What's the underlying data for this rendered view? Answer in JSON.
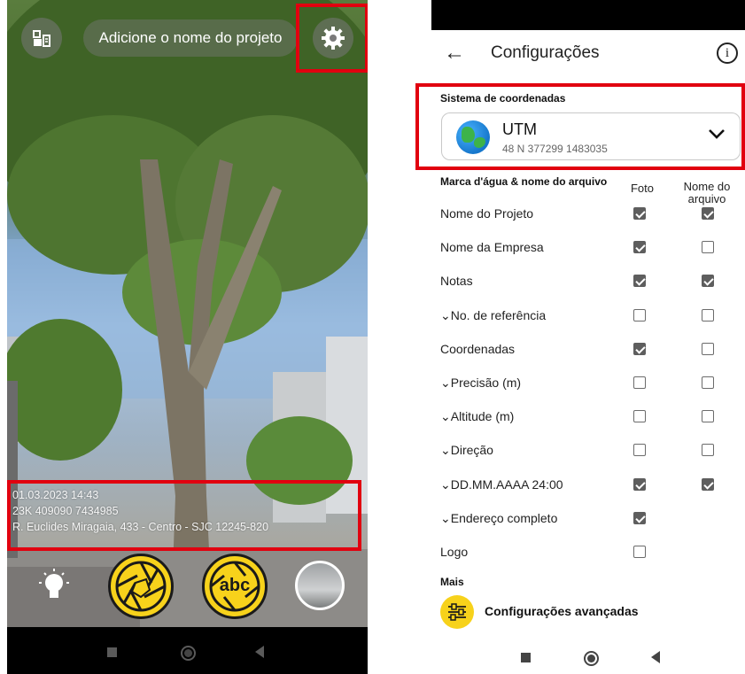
{
  "camera": {
    "project_name_placeholder": "Adicione o nome do projeto",
    "watermark": {
      "datetime": "01.03.2023 14:43",
      "coordinates": "23K 409090 7434985",
      "address": "R. Euclides Miragaia, 433 - Centro - SJC 12245-820"
    },
    "icons": {
      "project_icon": "project-folder-icon",
      "settings_icon": "gear-icon",
      "flash_icon": "bulb-icon",
      "shutter_icon": "aperture-icon",
      "shutter_text_icon": "abc-aperture-icon"
    },
    "shutter_text_label": "abc"
  },
  "settings": {
    "title": "Configurações",
    "coordinate_section_label": "Sistema de coordenadas",
    "coordinate_system": {
      "name": "UTM",
      "value": "48 N 377299 1483035"
    },
    "watermark_section_label": "Marca d'água & nome do arquivo",
    "col_photo": "Foto",
    "col_filename": "Nome do arquivo",
    "rows": [
      {
        "label": "Nome do Projeto",
        "photo": true,
        "file": true
      },
      {
        "label": "Nome da Empresa",
        "photo": true,
        "file": false
      },
      {
        "label": "Notas",
        "photo": true,
        "file": true
      },
      {
        "label": "⌄No. de referência",
        "photo": false,
        "file": false
      },
      {
        "label": "Coordenadas",
        "photo": true,
        "file": false
      },
      {
        "label": "⌄Precisão (m)",
        "photo": false,
        "file": false
      },
      {
        "label": "⌄Altitude (m)",
        "photo": false,
        "file": false
      },
      {
        "label": "⌄Direção",
        "photo": false,
        "file": false
      },
      {
        "label": "⌄DD.MM.AAAA 24:00",
        "photo": true,
        "file": true
      },
      {
        "label": "⌄Endereço completo",
        "photo": true,
        "file": null
      },
      {
        "label": "Logo",
        "photo": false,
        "file": null
      }
    ],
    "more_label": "Mais",
    "advanced_label": "Configurações avançadas"
  },
  "colors": {
    "highlight": "#e1000f",
    "shutter": "#f7d21b",
    "checkbox": "#5e5e5e"
  }
}
